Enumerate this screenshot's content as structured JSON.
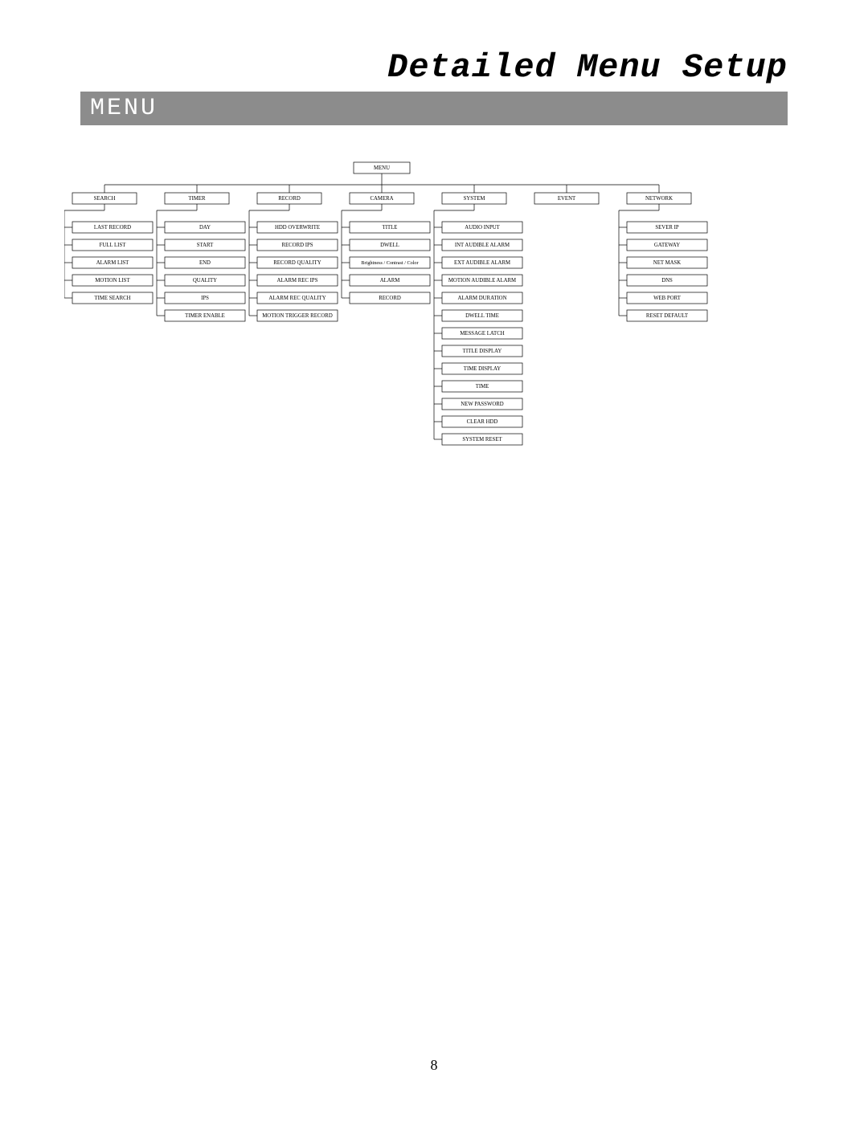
{
  "title": "Detailed Menu Setup",
  "menu_label": "MENU",
  "page_number": "8",
  "tree": {
    "root": "MENU",
    "columns": [
      {
        "header": "SEARCH",
        "items": [
          "LAST RECORD",
          "FULL LIST",
          "ALARM LIST",
          "MOTION LIST",
          "TIME SEARCH"
        ]
      },
      {
        "header": "TIMER",
        "items": [
          "DAY",
          "START",
          "END",
          "QUALITY",
          "IPS",
          "TIMER ENABLE"
        ]
      },
      {
        "header": "RECORD",
        "items": [
          "HDD OVERWRITE",
          "RECORD IPS",
          "RECORD QUALITY",
          "ALARM REC IPS",
          "ALARM REC QUALITY",
          "MOTION TRIGGER RECORD"
        ]
      },
      {
        "header": "CAMERA",
        "items": [
          "TITLE",
          "DWELL",
          "Brightness / Contrast / Color",
          "ALARM",
          "RECORD"
        ]
      },
      {
        "header": "SYSTEM",
        "items": [
          "AUDIO INPUT",
          "INT AUDIBLE ALARM",
          "EXT AUDIBLE ALARM",
          "MOTION AUDIBLE ALARM",
          "ALARM DURATION",
          "DWELL TIME",
          "MESSAGE LATCH",
          "TITLE DISPLAY",
          "TIME DISPLAY",
          "TIME",
          "NEW PASSWORD",
          "CLEAR HDD",
          "SYSTEM RESET"
        ]
      },
      {
        "header": "EVENT",
        "items": []
      },
      {
        "header": "NETWORK",
        "items": [
          "SEVER IP",
          "GATEWAY",
          "NET MASK",
          "DNS",
          "WEB PORT",
          "RESET DEFAULT"
        ]
      }
    ]
  }
}
